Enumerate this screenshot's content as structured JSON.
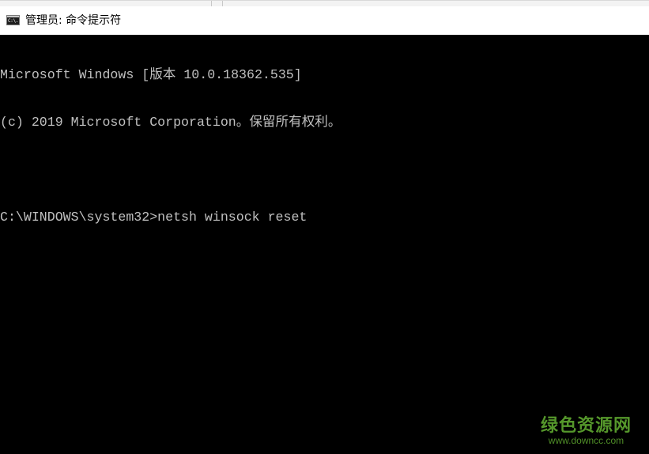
{
  "window": {
    "title": "管理员: 命令提示符",
    "icon": "cmd-console-icon",
    "icon_text": "C:\\."
  },
  "console": {
    "lines": [
      "Microsoft Windows [版本 10.0.18362.535]",
      "(c) 2019 Microsoft Corporation。保留所有权利。",
      ""
    ],
    "prompt": "C:\\WINDOWS\\system32>",
    "command": "netsh winsock reset"
  },
  "watermark": {
    "logo_text": "绿色资源网",
    "url": "www.downcc.com"
  },
  "colors": {
    "console_background": "#000000",
    "console_text": "#c0c0c0",
    "titlebar_background": "#ffffff",
    "watermark": "#5fa830"
  }
}
